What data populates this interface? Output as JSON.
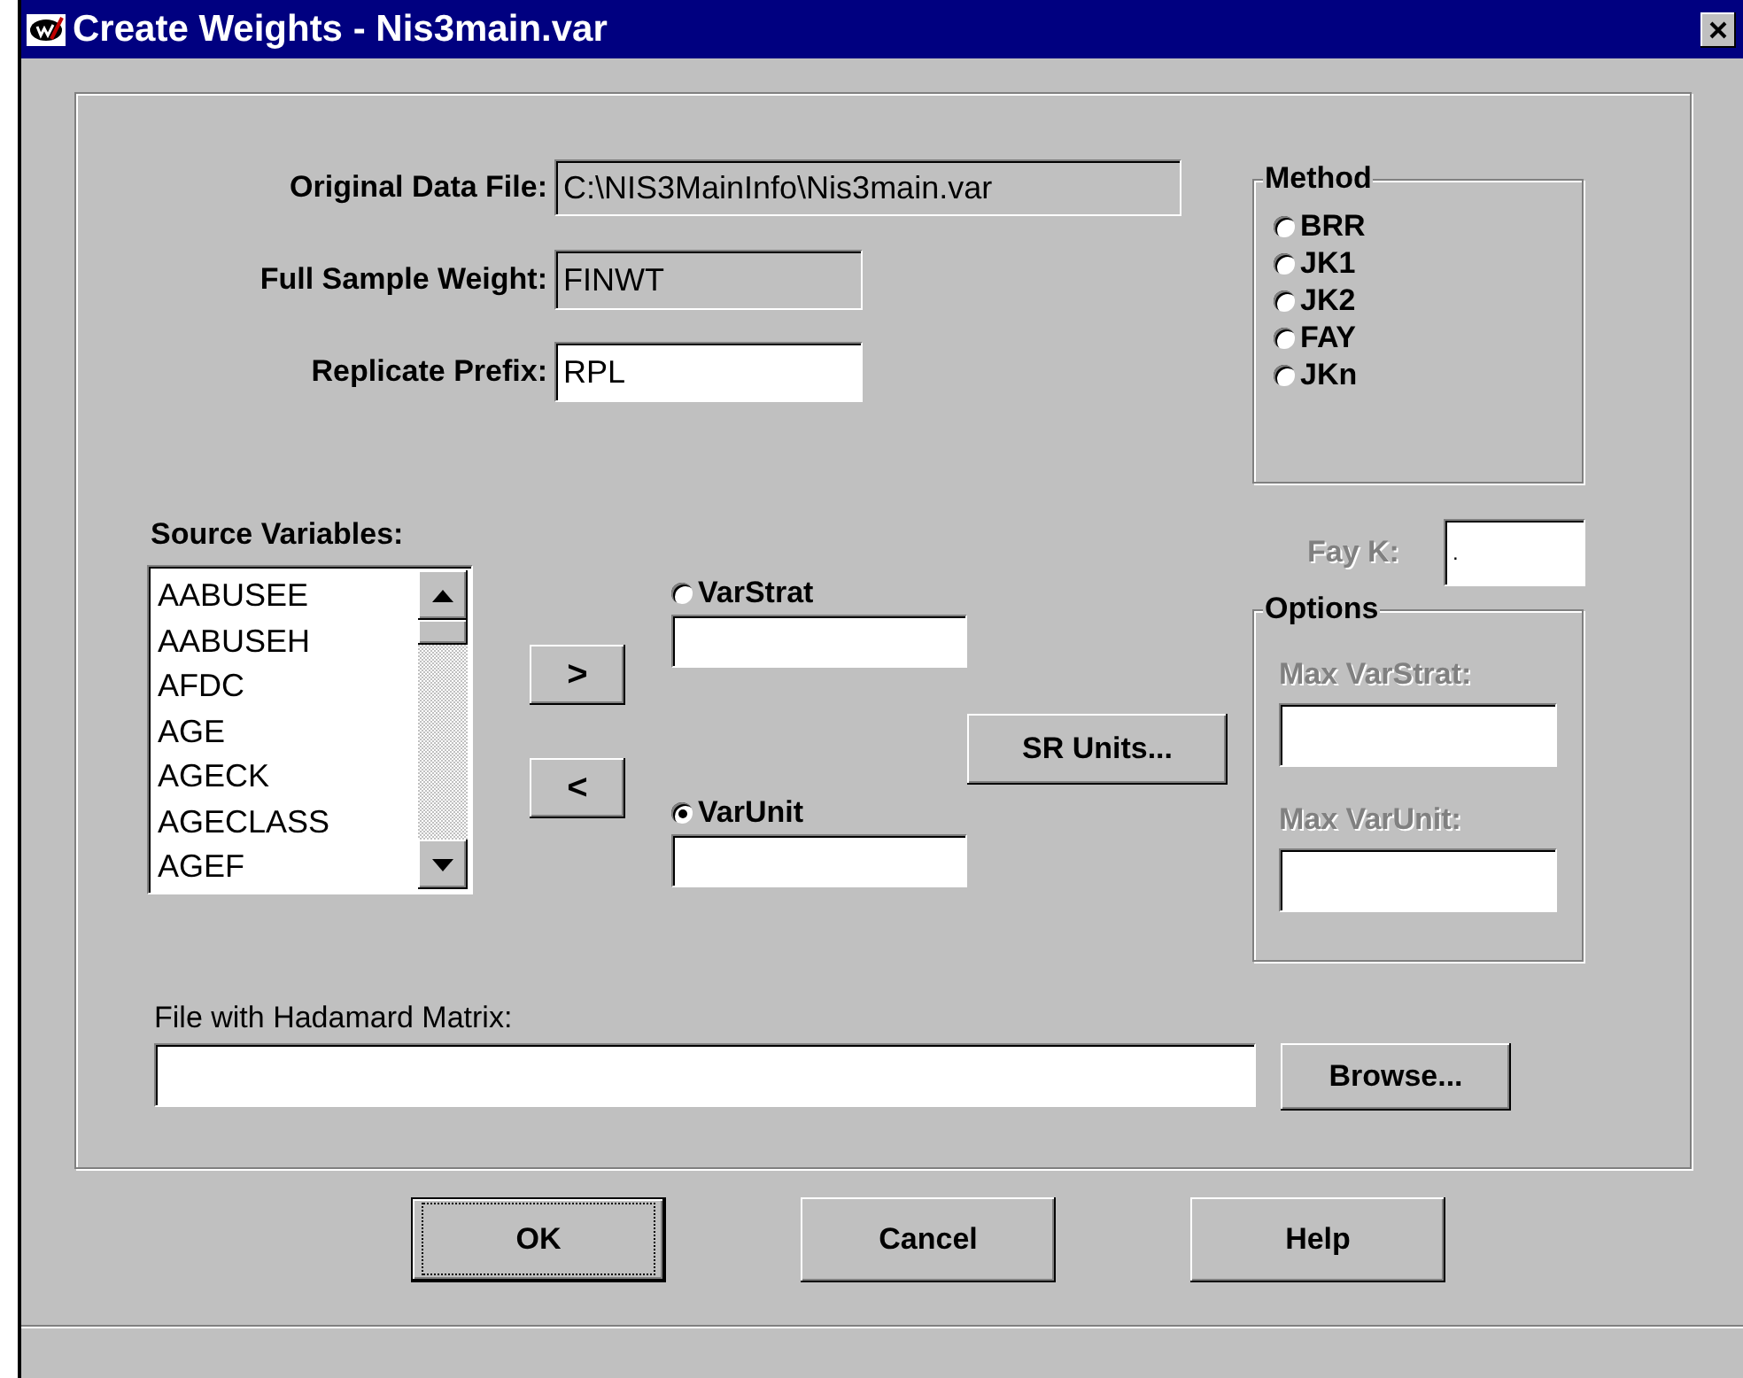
{
  "window": {
    "title": "Create Weights - Nis3main.var"
  },
  "fields": [
    {
      "label": "Original Data File:",
      "value": "C:\\NIS3MainInfo\\Nis3main.var",
      "readonly": true
    },
    {
      "label": "Full Sample Weight:",
      "value": "FINWT",
      "readonly": true
    },
    {
      "label": "Replicate Prefix:",
      "value": "RPL",
      "readonly": false
    }
  ],
  "source_variables": {
    "label": "Source Variables:",
    "items": [
      "AABUSEE",
      "AABUSEH",
      "AFDC",
      "AGE",
      "AGECK",
      "AGECLASS",
      "AGEF"
    ]
  },
  "move_buttons": [
    ">",
    "<"
  ],
  "design_vars": [
    {
      "label": "VarStrat",
      "selected": false
    },
    {
      "label": "VarUnit",
      "selected": true
    }
  ],
  "sr_units_button": "SR  Units...",
  "method": {
    "title": "Method",
    "options": [
      {
        "label": "BRR",
        "selected": false
      },
      {
        "label": "JK1",
        "selected": false
      },
      {
        "label": "JK2",
        "selected": false
      },
      {
        "label": "FAY",
        "selected": false
      },
      {
        "label": "JKn",
        "selected": false
      }
    ]
  },
  "fay_k": {
    "label": "Fay K:",
    "value": ".",
    "disabled": true
  },
  "options": {
    "title": "Options",
    "fields": [
      {
        "label": "Max VarStrat:",
        "disabled": true
      },
      {
        "label": "Max VarUnit:",
        "disabled": true
      }
    ]
  },
  "hadamard": {
    "label": "File with Hadamard Matrix:",
    "button": "Browse..."
  },
  "buttons": [
    {
      "label": "OK",
      "default": true
    },
    {
      "label": "Cancel",
      "default": false
    },
    {
      "label": "Help",
      "default": false
    }
  ]
}
